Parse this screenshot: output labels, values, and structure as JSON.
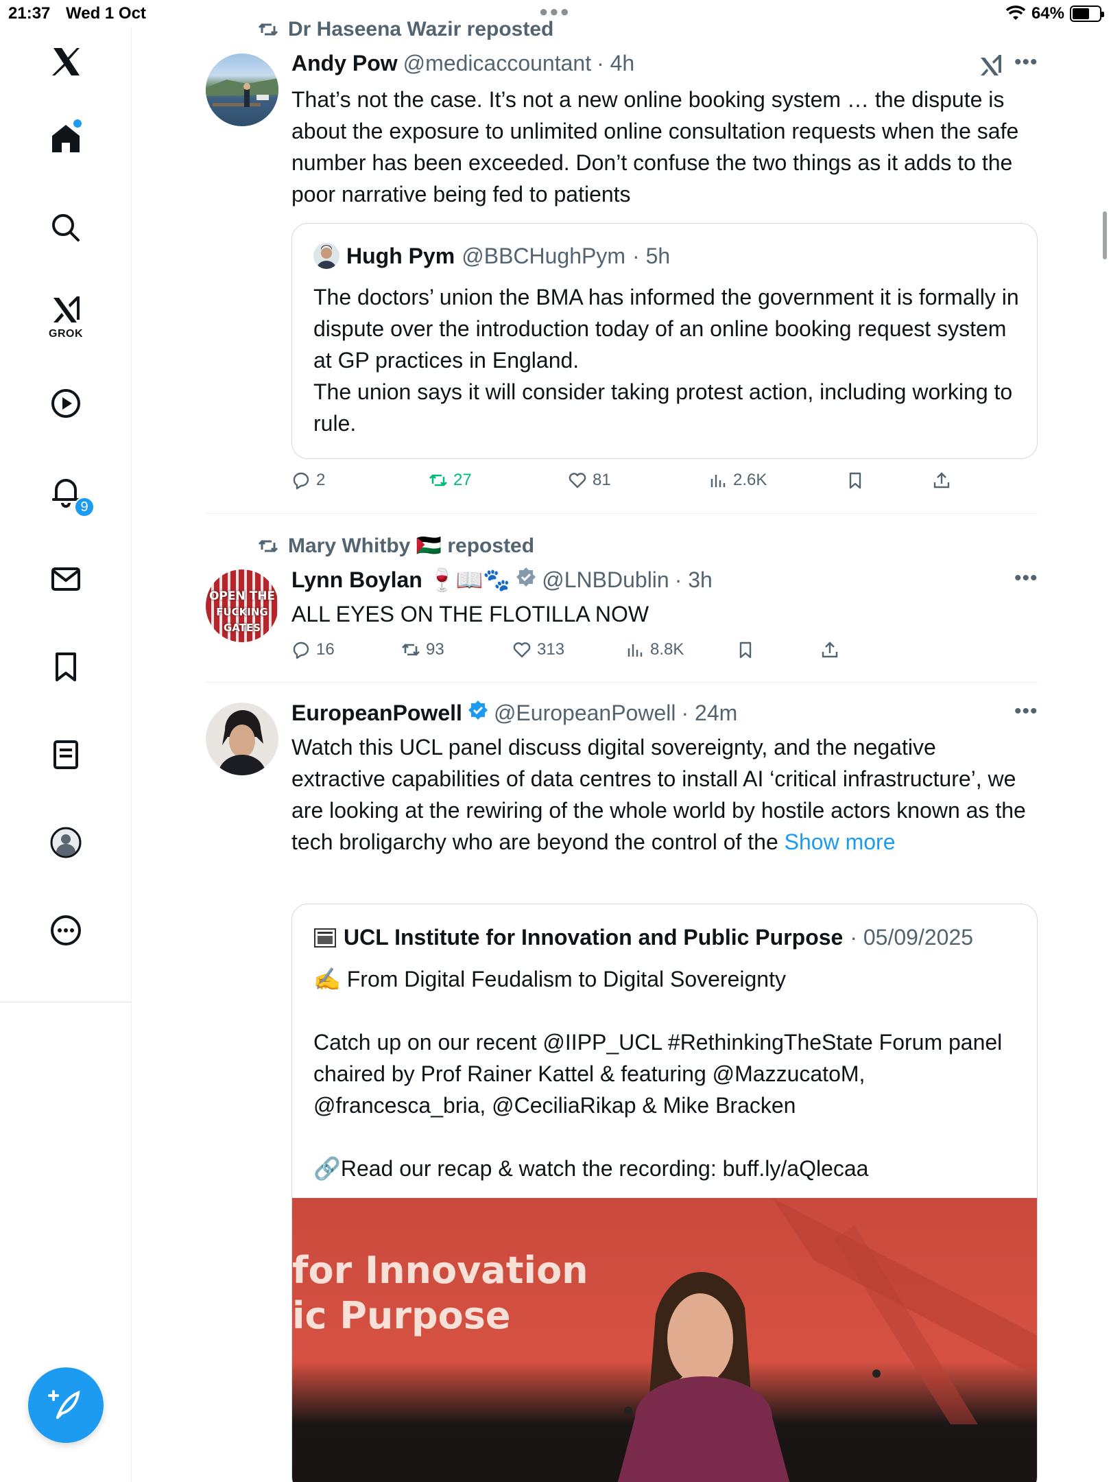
{
  "status_bar": {
    "time": "21:37",
    "date": "Wed 1 Oct",
    "battery": "64%",
    "battery_level": 0.64
  },
  "sidebar": {
    "grok_label": "GROK",
    "notifications_badge": "9"
  },
  "feed": {
    "tweets": [
      {
        "repost_by": "Dr Haseena Wazir reposted",
        "name": "Andy Pow",
        "handle": "@medicaccountant",
        "time": "· 4h",
        "body": "That’s  not the case. It’s not a new online booking system … the dispute is about the exposure to unlimited online consultation requests when the safe number has been exceeded. Don’t confuse the two things as it adds to the poor narrative being fed to patients",
        "quote": {
          "name": "Hugh Pym",
          "handle": "@BBCHughPym",
          "time": "· 5h",
          "body": "The doctors’ union the BMA has informed the government it is formally in dispute over the introduction today of an online booking request system at GP practices in England.\n The union says it will consider taking protest action, including working to rule."
        },
        "replies": "2",
        "reposts": "27",
        "likes": "81",
        "views": "2.6K"
      },
      {
        "repost_by": "Mary Whitby 🇵🇸 reposted",
        "name": "Lynn Boylan 🍷📖🐾",
        "handle": "@LNBDublin",
        "time": "· 3h",
        "body": "ALL EYES ON THE FLOTILLA NOW",
        "avatar_text_1": "OPEN THE",
        "avatar_text_2": "FUCKING GATES",
        "replies": "16",
        "reposts": "93",
        "likes": "313",
        "views": "8.8K"
      },
      {
        "name": "EuropeanPowell",
        "handle": "@EuropeanPowell",
        "time": "· 24m",
        "body": "Watch this UCL panel discuss digital sovereignty, and the negative extractive capabilities of data centres to install AI ‘critical infrastructure’, we are looking at the rewiring of the whole world by hostile actors known as the tech broligarchy who are beyond the control of the ",
        "show_more": "Show more",
        "quote": {
          "name": "UCL Institute for Innovation and Public Purpose",
          "time": "· 05/09/2025",
          "line1": "✍️ From Digital Feudalism to Digital Sovereignty",
          "line2": "Catch up on our recent @IIPP_UCL #RethinkingTheState Forum panel chaired by Prof Rainer Kattel & featuring @MazzucatoM, @francesca_bria, @CeciliaRikap & Mike Bracken",
          "line3": "🔗Read our recap & watch the recording: buff.ly/aQlecaa",
          "video_text_1": "for Innovation",
          "video_text_2": "ic Purpose"
        }
      }
    ]
  },
  "colors": {
    "accent": "#1d9bf0",
    "repost_green": "#00ba7c",
    "secondary_text": "#536471"
  }
}
